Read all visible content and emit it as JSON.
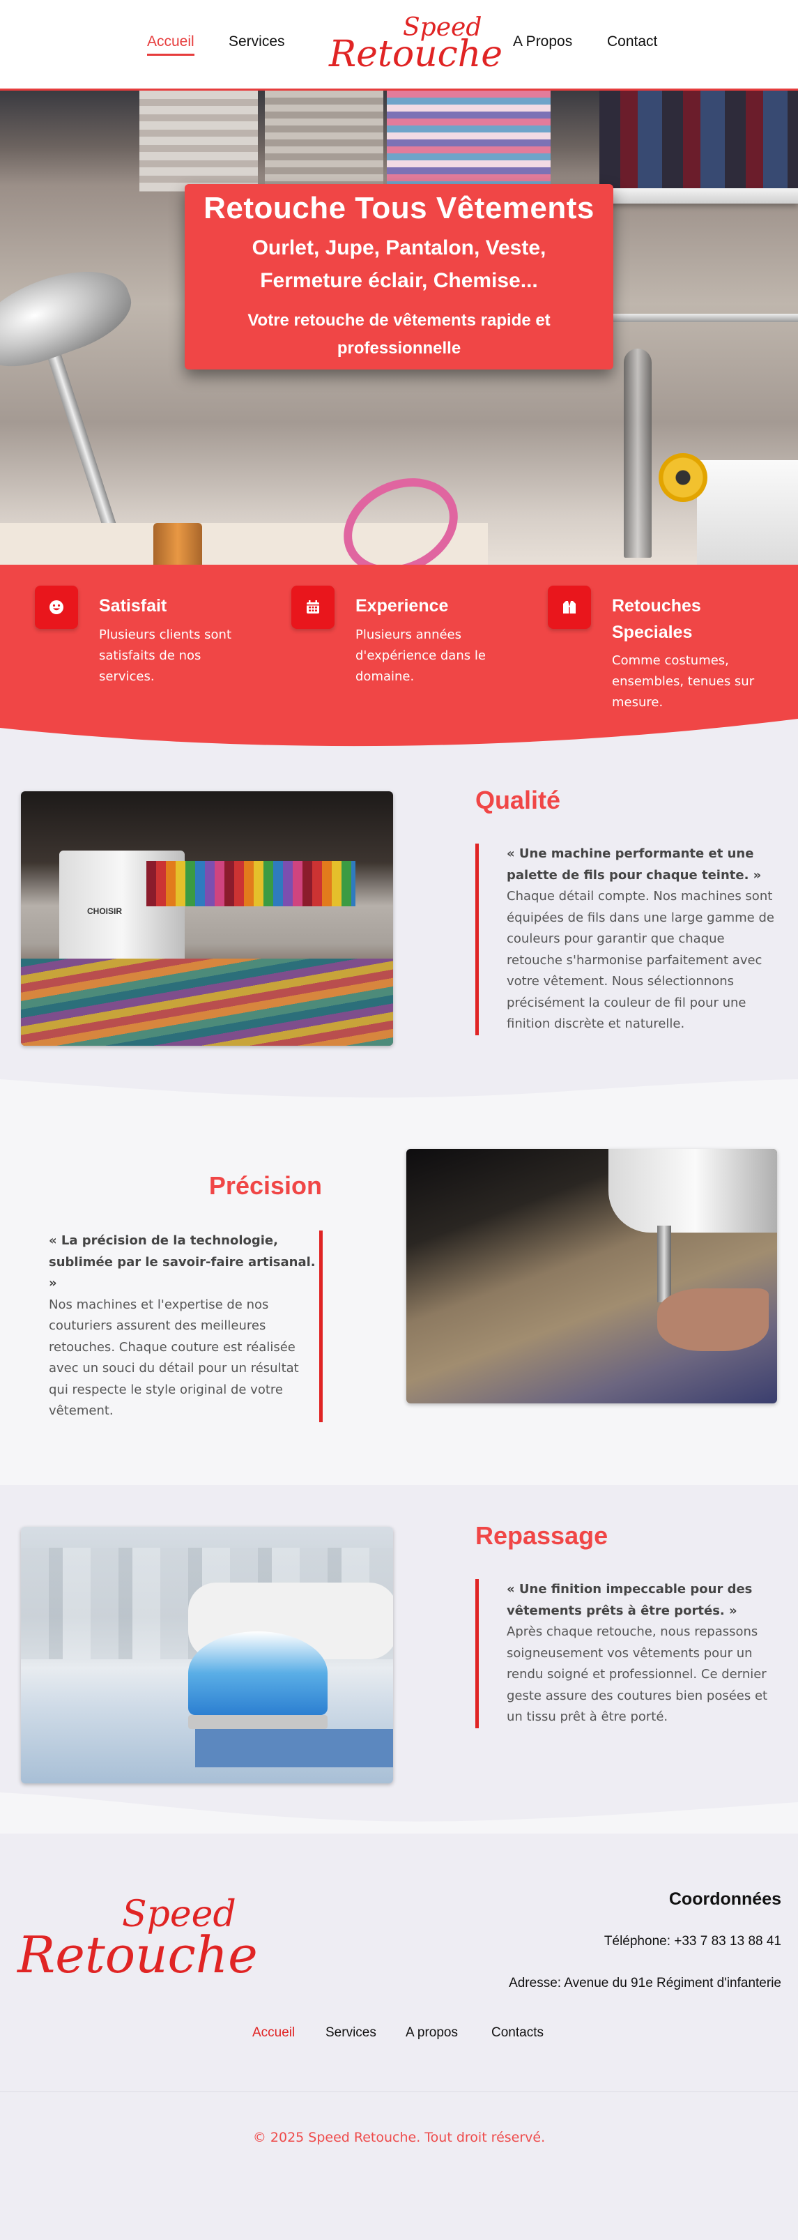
{
  "nav": {
    "left": [
      "Accueil",
      "Services"
    ],
    "right": [
      "A Propos",
      "Contact"
    ],
    "active": "Accueil"
  },
  "logo": {
    "line1": "Speed",
    "line2": "Retouche"
  },
  "hero": {
    "title": "Retouche Tous Vêtements",
    "subtitle": "Ourlet, Jupe, Pantalon, Veste, Fermeture éclair, Chemise...",
    "tagline": "Votre retouche de vêtements rapide et professionnelle"
  },
  "features": [
    {
      "icon": "smile-icon",
      "title": "Satisfait",
      "desc": "Plusieurs clients sont satisfaits de nos services."
    },
    {
      "icon": "calendar-icon",
      "title": "Experience",
      "desc": "Plusieurs années d'expérience dans le domaine."
    },
    {
      "icon": "suit-icon",
      "title": "Retouches Speciales",
      "desc": "Comme costumes, ensembles, tenues sur mesure."
    }
  ],
  "sections": [
    {
      "title": "Qualité",
      "quote": "« Une machine performante et une palette de fils pour chaque teinte. »",
      "body": "Chaque détail compte. Nos machines sont équipées de fils dans une large gamme de couleurs pour garantir que chaque retouche s'harmonise parfaitement avec votre vêtement. Nous sélectionnons précisément la couleur de fil pour une finition discrète et naturelle.",
      "image_label": "CHOISIR"
    },
    {
      "title": "Précision",
      "quote": "« La précision de la technologie, sublimée par le savoir-faire artisanal. »",
      "body": "Nos machines et l'expertise de nos couturiers assurent des meilleures retouches. Chaque couture est réalisée avec un souci du détail pour un résultat qui respecte le style original de votre vêtement."
    },
    {
      "title": "Repassage",
      "quote": "« Une finition impeccable pour des vêtements prêts à être portés. »",
      "body": "Après chaque retouche, nous repassons soigneusement vos vêtements pour un rendu soigné et professionnel. Ce dernier geste assure des coutures bien posées et un tissu prêt à être porté."
    }
  ],
  "footer": {
    "coord_title": "Coordonnées",
    "phone": "Téléphone: +33 7 83 13 88 41",
    "address": "Adresse: Avenue du 91e Régiment d'infanterie",
    "links": [
      "Accueil",
      "Services",
      "A propos",
      "Contacts"
    ],
    "active": "Accueil",
    "copyright": "© 2025 Speed Retouche. Tout droit réservé."
  },
  "colors": {
    "accent": "#f04646",
    "accent_dark": "#e02424",
    "background": "#eeedf3"
  }
}
